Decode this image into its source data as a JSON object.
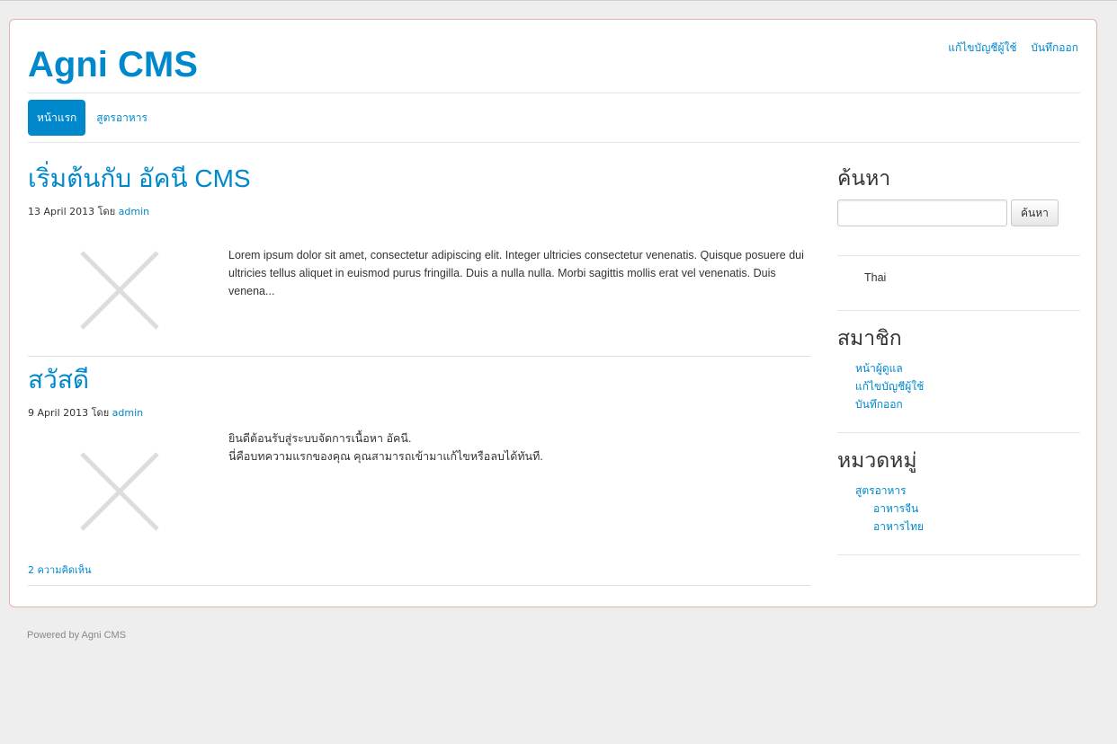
{
  "header": {
    "site_title": "Agni CMS",
    "user_links": [
      "แก้ไขบัญชีผู้ใช้",
      "บันทึกออก"
    ]
  },
  "nav": {
    "items": [
      {
        "label": "หน้าแรก",
        "active": true
      },
      {
        "label": "สูตรอาหาร",
        "active": false
      }
    ]
  },
  "posts": [
    {
      "title": "เริ่มต้นกับ อัคนี CMS",
      "date": "13 April 2013",
      "by": "โดย",
      "author": "admin",
      "body_lines": [
        "Lorem ipsum dolor sit amet, consectetur adipiscing elit. Integer ultricies consectetur venenatis. Quisque posuere dui",
        "ultricies tellus aliquet in euismod purus fringilla. Duis a nulla nulla. Morbi sagittis mollis erat vel venenatis. Duis",
        "venena..."
      ]
    },
    {
      "title": "สวัสดี",
      "date": "9 April 2013",
      "by": "โดย",
      "author": "admin",
      "body_lines": [
        "ยินดีต้อนรับสู่ระบบจัดการเนื้อหา อัคนี.",
        "นี่คือบทความแรกของคุณ คุณสามารถเข้ามาแก้ไขหรือลบได้ทันที."
      ],
      "comments": "2 ความคิดเห็น"
    }
  ],
  "sidebar": {
    "search": {
      "heading": "ค้นหา",
      "button_label": "ค้นหา",
      "value": ""
    },
    "language": "Thai",
    "members": {
      "heading": "สมาชิก",
      "links": [
        "หน้าผู้ดูแล",
        "แก้ไขบัญชีผู้ใช้",
        "บันทึกออก"
      ]
    },
    "categories": {
      "heading": "หมวดหมู่",
      "parent": "สูตรอาหาร",
      "children": [
        "อาหารจีน",
        "อาหารไทย"
      ]
    }
  },
  "footer": {
    "text": "Powered by Agni CMS"
  },
  "colors": {
    "accent": "#0088cc",
    "background": "#eeeeee",
    "card_border": "#e2b2a8",
    "placeholder_icon": "#dddddd"
  }
}
